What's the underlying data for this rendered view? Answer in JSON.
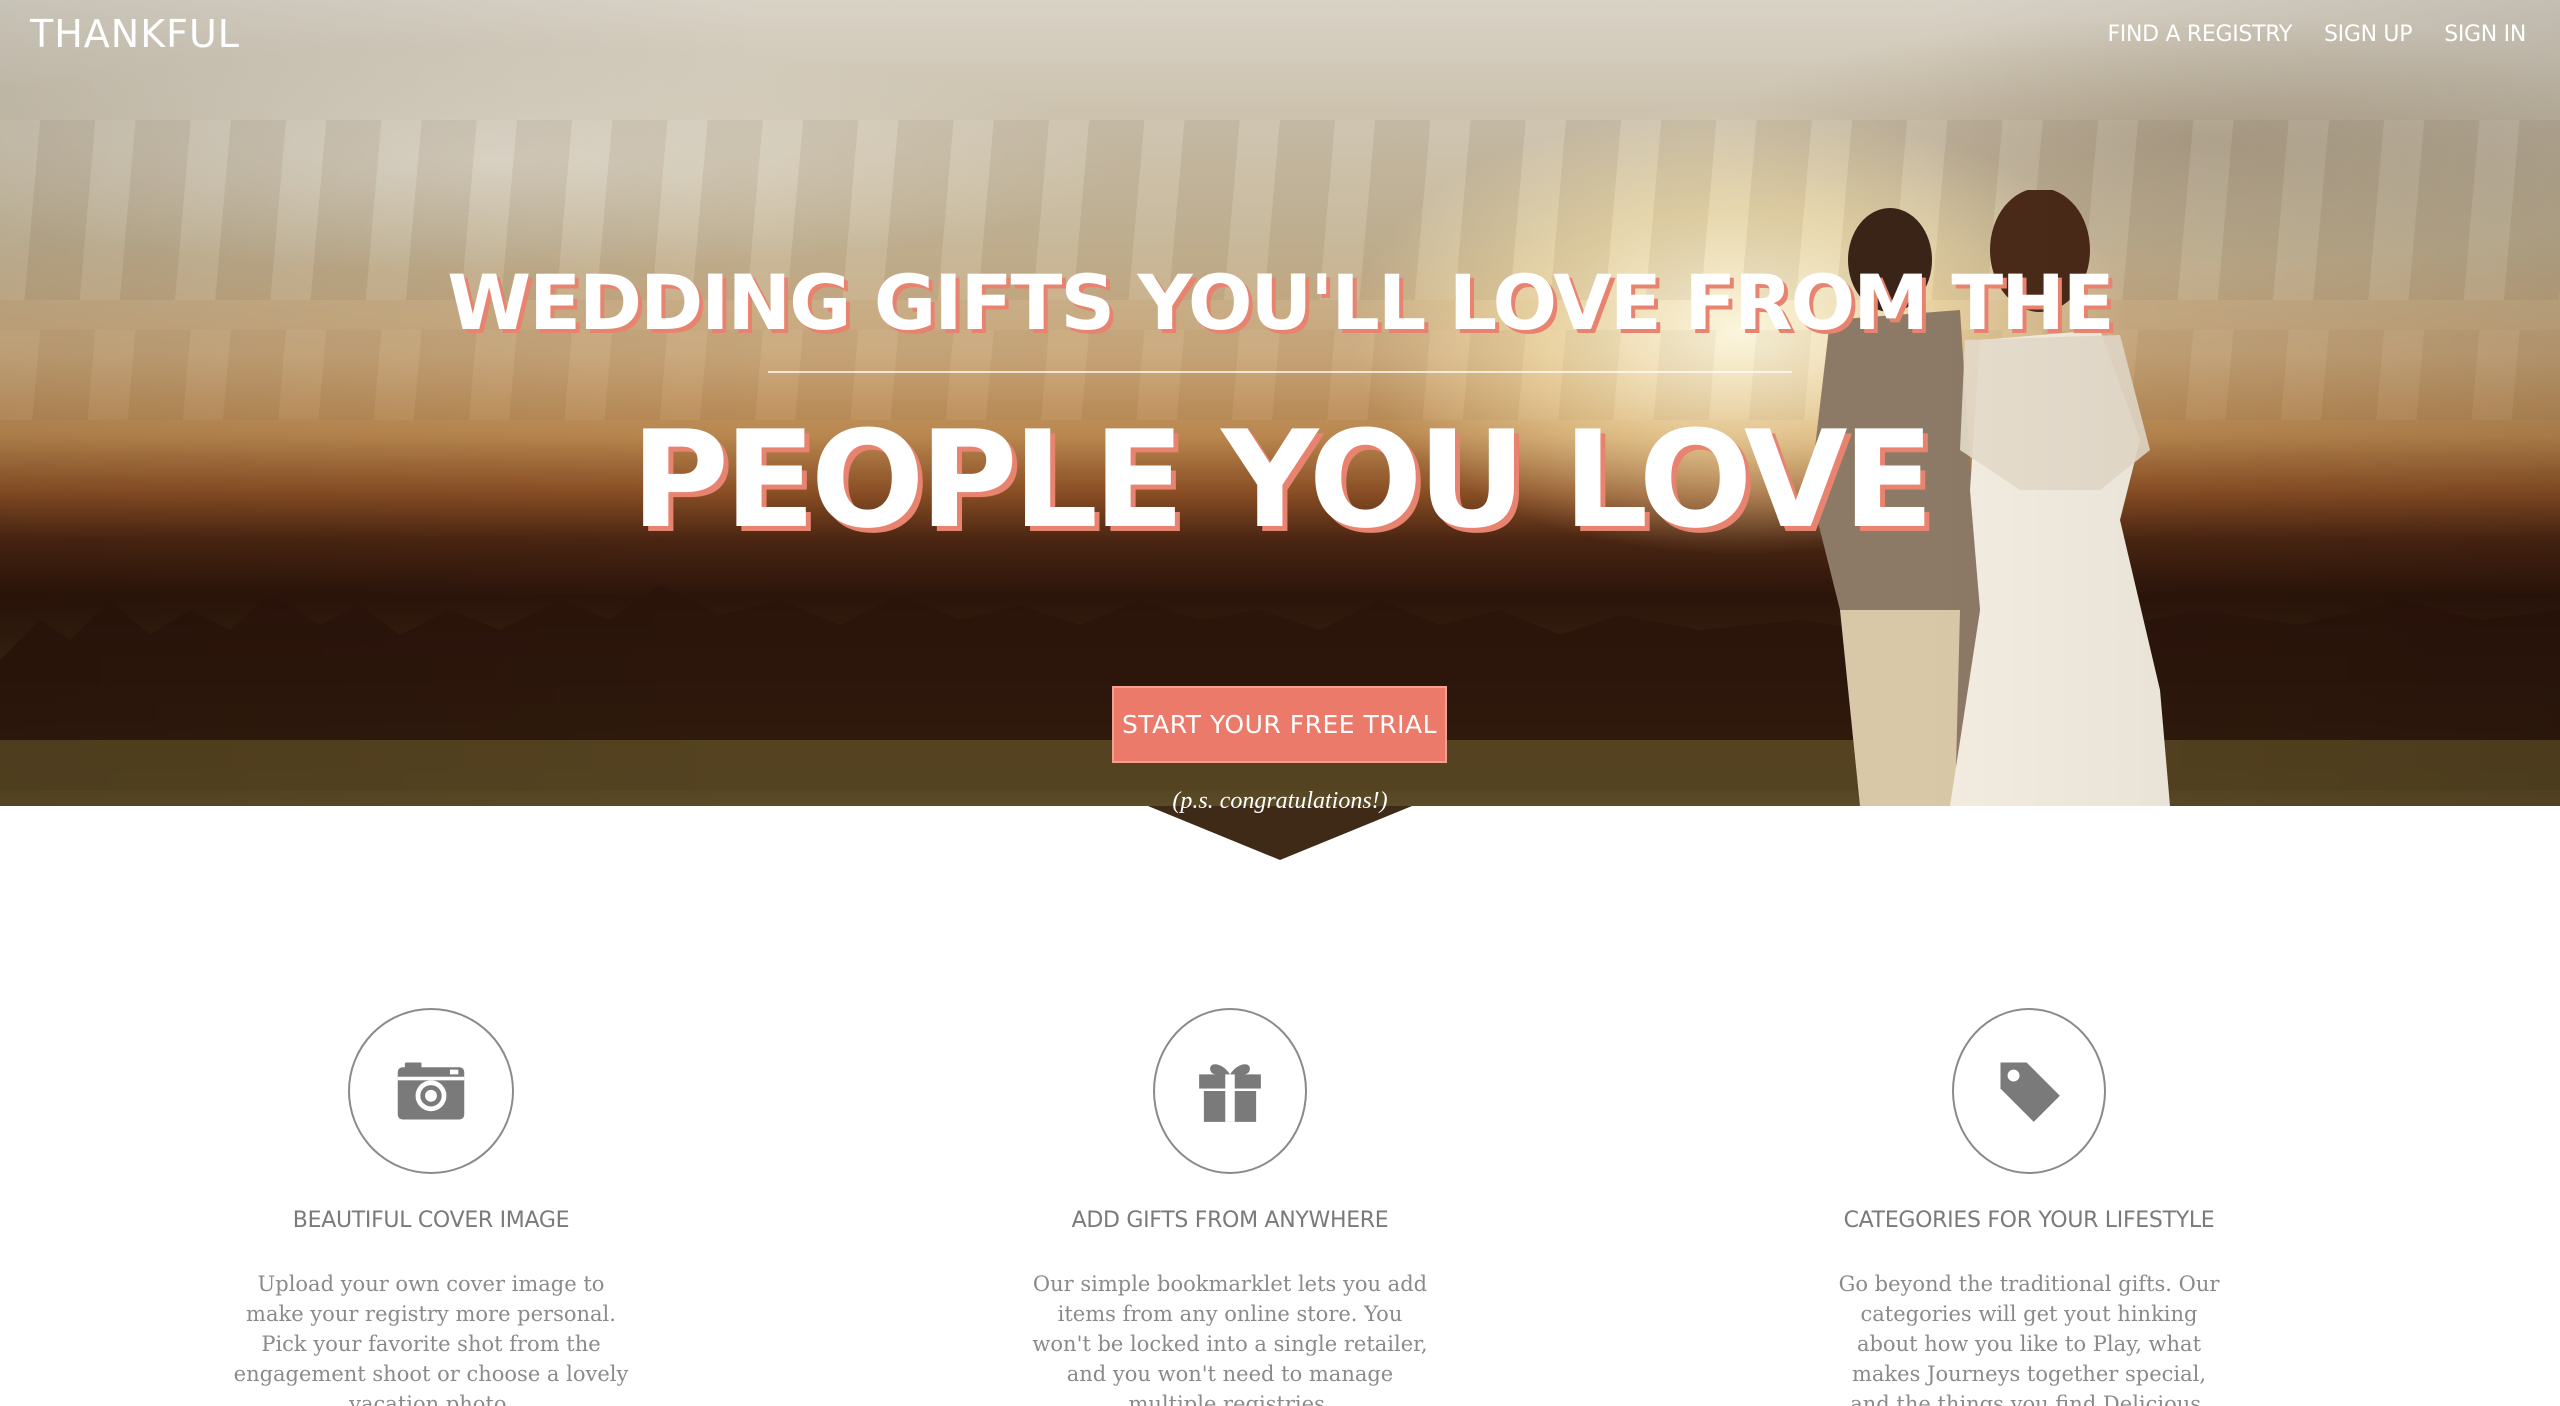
{
  "brand": "THANKFUL",
  "nav": {
    "find_registry": "FIND A REGISTRY",
    "sign_up": "SIGN UP",
    "sign_in": "SIGN IN"
  },
  "hero": {
    "headline_top": "WEDDING GIFTS YOU'LL LOVE FROM THE",
    "headline_big": "PEOPLE YOU LOVE",
    "cta": "START YOUR FREE TRIAL",
    "note": "(p.s. congratulations!)"
  },
  "features": [
    {
      "icon": "camera-icon",
      "title": "BEAUTIFUL COVER IMAGE",
      "text": "Upload your own cover image to make your registry more personal. Pick your favorite shot from the engagement shoot or choose a lovely vacation photo."
    },
    {
      "icon": "gift-icon",
      "title": "ADD GIFTS FROM ANYWHERE",
      "text": "Our simple bookmarklet lets you add items from any online store. You won't be locked into a single retailer, and you won't need to manage multiple registries."
    },
    {
      "icon": "tag-icon",
      "title": "CATEGORIES FOR YOUR LIFESTYLE",
      "text": "Go beyond the traditional gifts. Our categories will get yout hinking about how you like to Play, what makes Journeys together special, and the things you find Delicious."
    }
  ],
  "colors": {
    "accent": "#ec7a6a",
    "text_gray": "#7a7a7a"
  }
}
